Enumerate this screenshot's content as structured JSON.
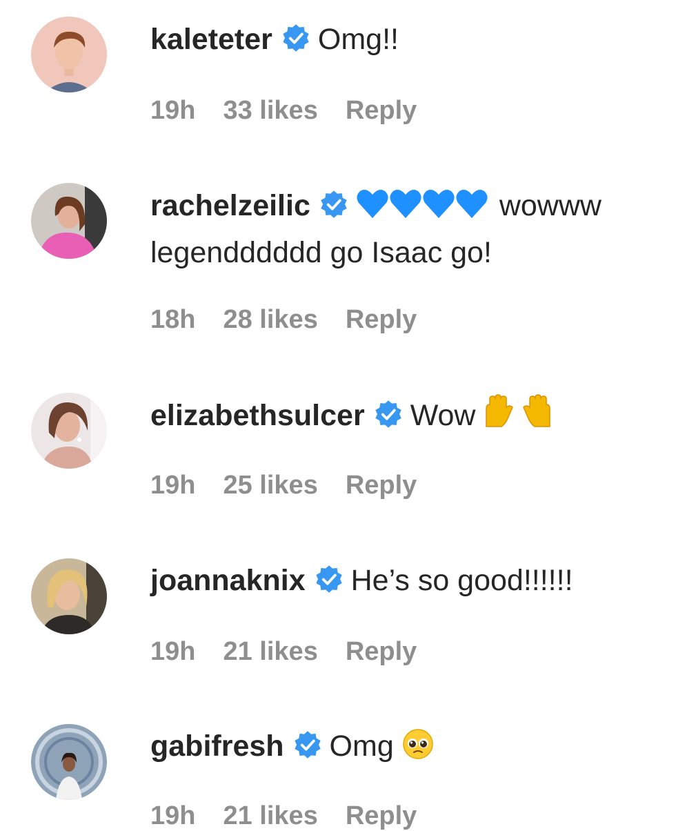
{
  "comments": [
    {
      "username": "kaleteter",
      "text": "Omg!!",
      "time": "19h",
      "likes": "33 likes",
      "reply": "Reply"
    },
    {
      "username": "rachelzeilic",
      "text_suffix": "wowww legendddddd go Isaac go!",
      "emoji": "blue-heart x4",
      "time": "18h",
      "likes": "28 likes",
      "reply": "Reply"
    },
    {
      "username": "elizabethsulcer",
      "text": "Wow",
      "emoji": "raising-hands",
      "time": "19h",
      "likes": "25 likes",
      "reply": "Reply"
    },
    {
      "username": "joannaknix",
      "text": "He’s so good!!!!!!",
      "time": "19h",
      "likes": "21 likes",
      "reply": "Reply"
    },
    {
      "username": "gabifresh",
      "text": "Omg",
      "emoji": "pleading-face",
      "time": "19h",
      "likes": "21 likes",
      "reply": "Reply"
    }
  ],
  "colors": {
    "text": "#262626",
    "meta": "#8e8e8e",
    "verified": "#3897f0",
    "heart": "#1e90ff"
  }
}
